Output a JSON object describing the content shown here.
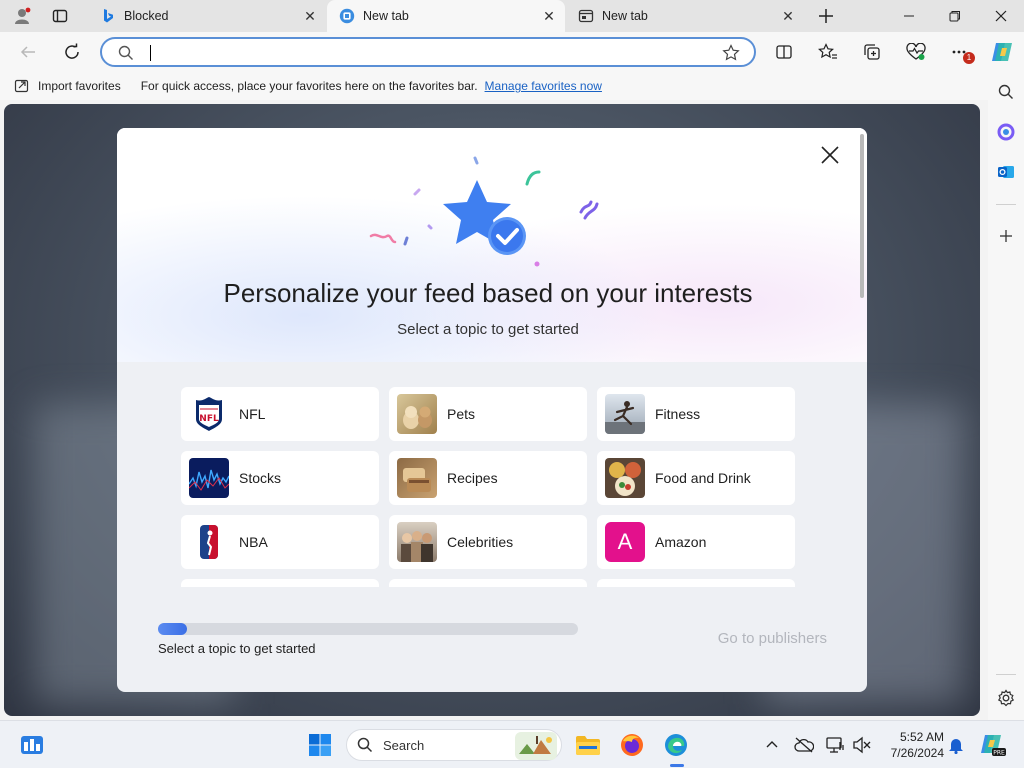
{
  "tabs": [
    {
      "title": "Blocked",
      "icon": "bing-icon",
      "active": false
    },
    {
      "title": "New tab",
      "icon": "edge-newtab-icon",
      "active": true
    },
    {
      "title": "New tab",
      "icon": "newtab-icon",
      "active": false
    }
  ],
  "toolbar": {
    "address_value": "",
    "address_placeholder": ""
  },
  "favorites_bar": {
    "import_label": "Import favorites",
    "hint": "For quick access, place your favorites here on the favorites bar.",
    "manage_link": "Manage favorites now"
  },
  "notifications": {
    "more_badge": "1"
  },
  "modal": {
    "title": "Personalize your feed based on your interests",
    "subtitle": "Select a topic to get started",
    "topics": [
      {
        "label": "NFL",
        "icon": "nfl-logo"
      },
      {
        "label": "Pets",
        "icon": "pets-photo"
      },
      {
        "label": "Fitness",
        "icon": "fitness-photo"
      },
      {
        "label": "Stocks",
        "icon": "stocks-photo"
      },
      {
        "label": "Recipes",
        "icon": "recipes-photo"
      },
      {
        "label": "Food and Drink",
        "icon": "food-photo"
      },
      {
        "label": "NBA",
        "icon": "nba-logo"
      },
      {
        "label": "Celebrities",
        "icon": "celebrities-photo"
      },
      {
        "label": "Amazon",
        "icon": "amazon-letter",
        "letter": "A"
      }
    ],
    "progress_text": "Select a topic to get started",
    "progress_fraction": 0.07,
    "go_button": "Go to publishers"
  },
  "taskbar": {
    "search_label": "Search",
    "time": "5:52 AM",
    "date": "7/26/2024"
  },
  "colors": {
    "accent": "#3b6fe6",
    "link": "#1a62c4",
    "amazon": "#e3118c"
  }
}
